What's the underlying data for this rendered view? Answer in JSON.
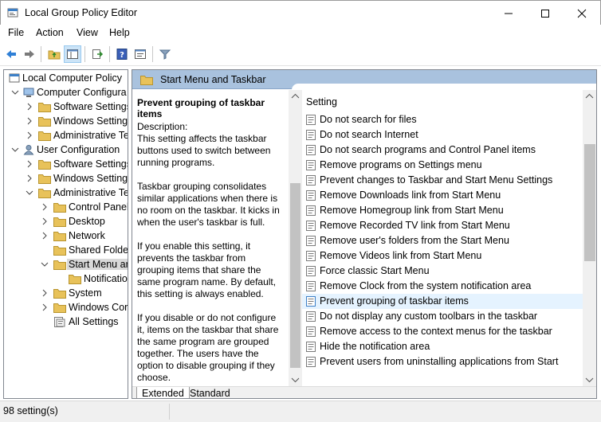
{
  "window": {
    "title": "Local Group Policy Editor"
  },
  "menu": [
    "File",
    "Action",
    "View",
    "Help"
  ],
  "toolbar": {
    "icons": [
      "back-arrow-icon",
      "forward-arrow-icon",
      "up-folder-icon",
      "show-hide-tree-icon",
      "export-list-icon",
      "help-icon",
      "properties-icon",
      "filter-icon"
    ]
  },
  "tree": {
    "root": "Local Computer Policy",
    "computer_config": "Computer Configura",
    "cc_software": "Software Settings",
    "cc_windows": "Windows Setting",
    "cc_admin": "Administrative Te",
    "user_config": "User Configuration",
    "uc_software": "Software Settings",
    "uc_windows": "Windows Setting",
    "uc_admin": "Administrative Te",
    "control_panel": "Control Panel",
    "desktop": "Desktop",
    "network": "Network",
    "shared_folders": "Shared Folder",
    "start_menu": "Start Menu ar",
    "notifications": "Notificatio",
    "system": "System",
    "windows_components": "Windows Cor",
    "all_settings": "All Settings"
  },
  "right": {
    "header": "Start Menu and Taskbar",
    "desc_title": "Prevent grouping of taskbar items",
    "desc_text": "Description:\nThis setting affects the taskbar buttons used to switch between running programs.\n\nTaskbar grouping consolidates similar applications when there is no room on the taskbar. It kicks in when the user's taskbar is full.\n\nIf you enable this setting, it prevents the taskbar from grouping items that share the same program name. By default, this setting is always enabled.\n\nIf you disable or do not configure it, items on the taskbar that share the same program are grouped together. The users have the option to disable grouping if they choose.",
    "column_header": "Setting",
    "settings": [
      "Do not search for files",
      "Do not search Internet",
      "Do not search programs and Control Panel items",
      "Remove programs on Settings menu",
      "Prevent changes to Taskbar and Start Menu Settings",
      "Remove Downloads link from Start Menu",
      "Remove Homegroup link from Start Menu",
      "Remove Recorded TV link from Start Menu",
      "Remove user's folders from the Start Menu",
      "Remove Videos link from Start Menu",
      "Force classic Start Menu",
      "Remove Clock from the system notification area",
      "Prevent grouping of taskbar items",
      "Do not display any custom toolbars in the taskbar",
      "Remove access to the context menus for the taskbar",
      "Hide the notification area",
      "Prevent users from uninstalling applications from Start"
    ],
    "selected_index": 12,
    "tabs": [
      "Extended",
      "Standard"
    ]
  },
  "status": {
    "text": "98 setting(s)"
  },
  "colors": {
    "header_blue": "#a9c2de",
    "selection": "#e5f3ff",
    "folder": "#e8c25a"
  }
}
